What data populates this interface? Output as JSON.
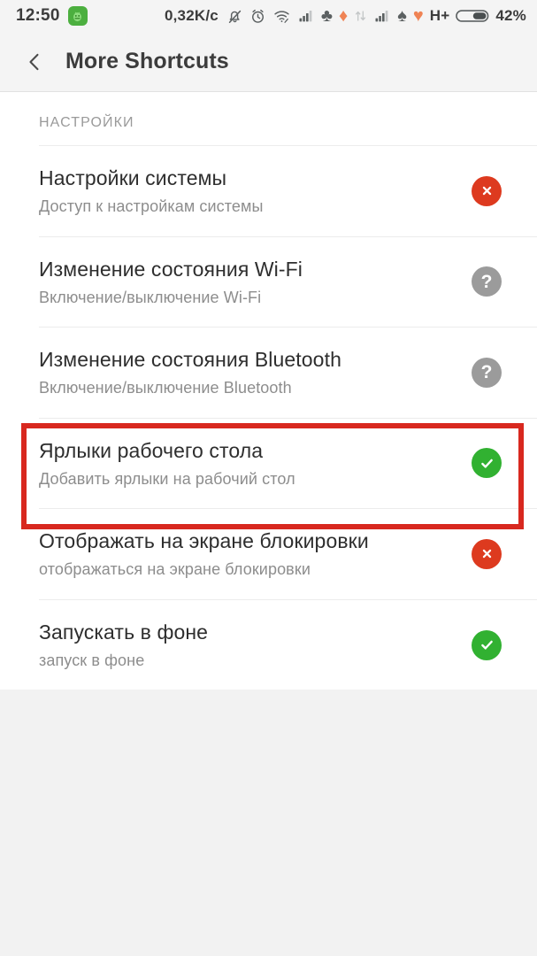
{
  "status_bar": {
    "clock": "12:50",
    "app_icon": "android-robot-icon",
    "data_rate": "0,32K/c",
    "icons": [
      "bell-muted-icon",
      "alarm-clock-icon",
      "wifi-icon",
      "signal-bars-icon",
      "clubs-suit-icon",
      "diamond-suit-icon",
      "data-transfer-icon",
      "signal-bars-2-icon",
      "spade-suit-icon",
      "heart-suit-icon"
    ],
    "clubs_glyph": "♣",
    "diamond_glyph": "♦",
    "spade_glyph": "♠",
    "heart_glyph": "♥",
    "network_type": "H+",
    "battery_percent": "42%",
    "colors": {
      "app_icon_green": "#4caf3f",
      "diamond_orange": "#ef8354",
      "heart_orange": "#ef8354",
      "suit_dark": "#5b6061",
      "text": "#3c3c3c",
      "background": "#f4f4f4"
    }
  },
  "header": {
    "back_icon": "chevron-left-icon",
    "title": "More Shortcuts"
  },
  "settings_section": {
    "label": "НАСТРОЙКИ"
  },
  "rows": [
    {
      "title": "Настройки системы",
      "subtitle": "Доступ к настройкам системы",
      "status": "denied",
      "badge_icon": "cross-circle-icon",
      "badge_color": "#dd3a1f"
    },
    {
      "title": "Изменение состояния Wi-Fi",
      "subtitle": "Включение/выключение Wi-Fi",
      "status": "ask",
      "badge_icon": "question-circle-icon",
      "badge_color": "#9b9b9b",
      "badge_text": "?"
    },
    {
      "title": "Изменение состояния Bluetooth",
      "subtitle": "Включение/выключение Bluetooth",
      "status": "ask",
      "badge_icon": "question-circle-icon",
      "badge_color": "#9b9b9b",
      "badge_text": "?"
    },
    {
      "title": "Ярлыки рабочего стола",
      "subtitle": "Добавить ярлыки на рабочий стол",
      "status": "allowed",
      "badge_icon": "check-circle-icon",
      "badge_color": "#31b131",
      "highlighted": true
    },
    {
      "title": "Отображать на экране блокировки",
      "subtitle": "отображаться на экране блокировки",
      "status": "denied",
      "badge_icon": "cross-circle-icon",
      "badge_color": "#dd3a1f"
    },
    {
      "title": "Запускать в фоне",
      "subtitle": "запуск в фоне",
      "status": "allowed",
      "badge_icon": "check-circle-icon",
      "badge_color": "#31b131"
    }
  ],
  "annotation": {
    "shape": "rectangle",
    "color": "#d8281f",
    "targets_row_index": 3
  }
}
